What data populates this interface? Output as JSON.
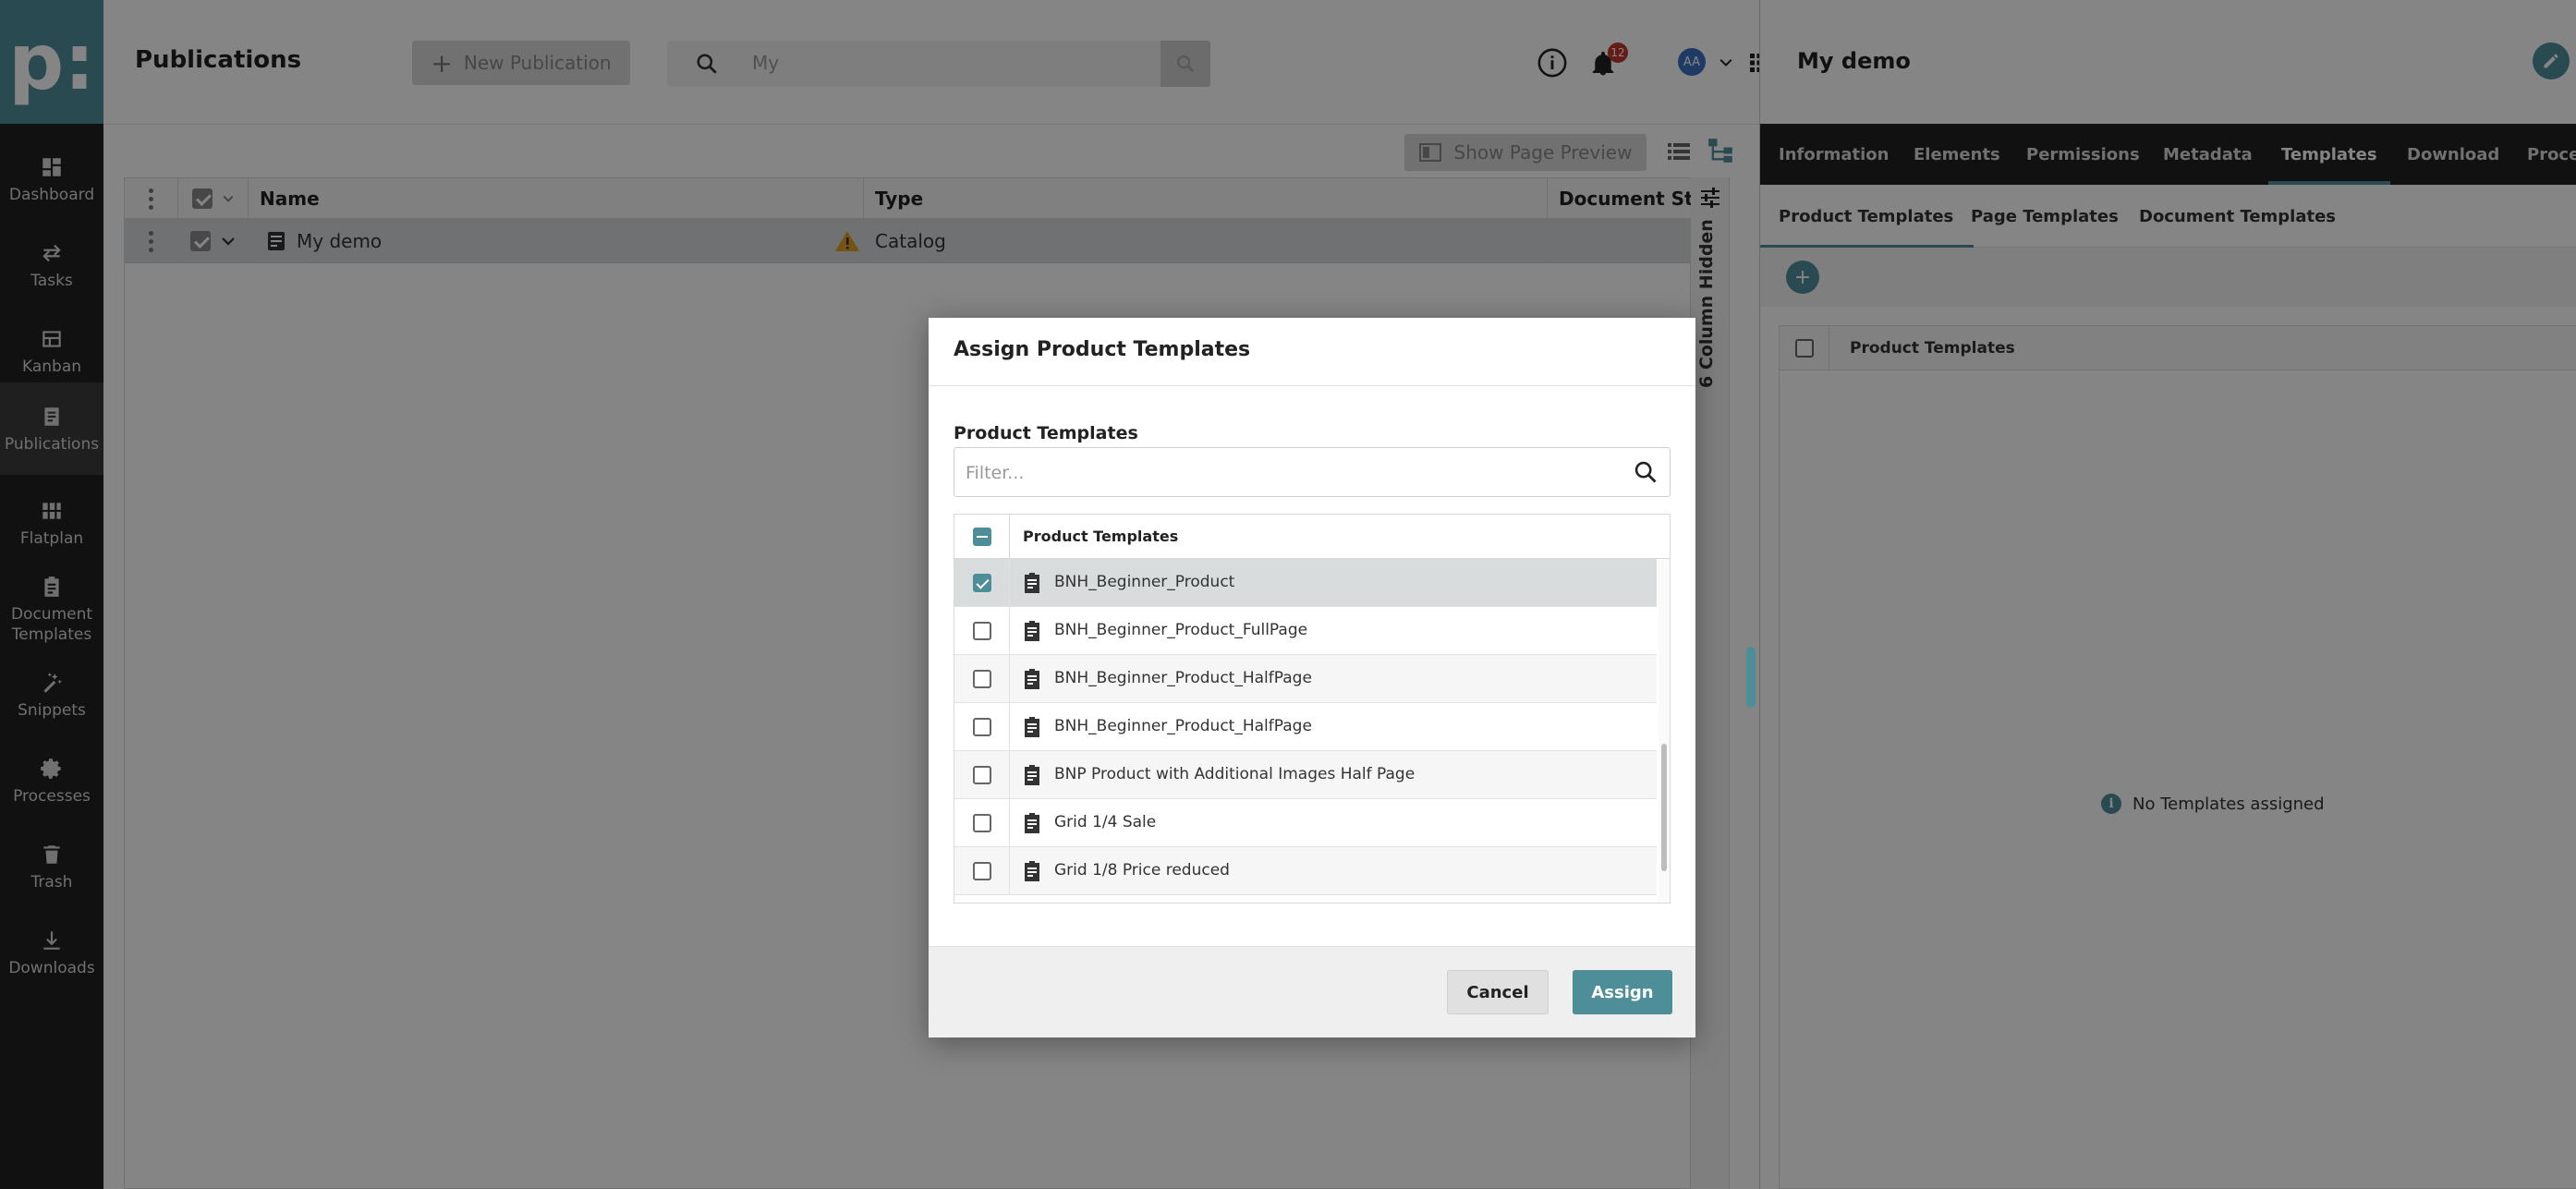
{
  "app": {
    "logo_text": "p:",
    "accent_color": "#4e8e99",
    "sidebar_bg": "#222222"
  },
  "sidebar": {
    "items": [
      {
        "label": "Dashboard",
        "icon": "dashboard-icon"
      },
      {
        "label": "Tasks",
        "icon": "tasks-icon"
      },
      {
        "label": "Kanban",
        "icon": "kanban-icon"
      },
      {
        "label": "Publications",
        "icon": "publications-icon",
        "active": true
      },
      {
        "label": "Flatplan",
        "icon": "flatplan-icon"
      },
      {
        "label": "Document\nTemplates",
        "icon": "document-templates-icon"
      },
      {
        "label": "Snippets",
        "icon": "snippets-icon"
      },
      {
        "label": "Processes",
        "icon": "gear-icon"
      },
      {
        "label": "Trash",
        "icon": "trash-icon"
      },
      {
        "label": "Downloads",
        "icon": "download-icon"
      }
    ]
  },
  "header": {
    "title": "Publications",
    "new_publication_label": "New Publication",
    "search_value": "My",
    "notification_count": "12",
    "avatar_initials": "AA"
  },
  "toolbar": {
    "show_page_preview_label": "Show Page Preview"
  },
  "grid": {
    "columns": [
      "Name",
      "Type",
      "Document St..."
    ],
    "rows": [
      {
        "name": "My demo",
        "type": "Catalog",
        "has_warning": true
      }
    ],
    "hidden_columns_label": "6 Column Hidden"
  },
  "right_panel": {
    "title": "My demo",
    "tabs": [
      "Information",
      "Elements",
      "Permissions",
      "Metadata",
      "Templates",
      "Download",
      "Proces"
    ],
    "active_tab": "Templates",
    "subtabs": [
      "Product Templates",
      "Page Templates",
      "Document Templates"
    ],
    "active_subtab": "Product Templates",
    "table_header": "Product Templates",
    "empty_message": "No Templates assigned"
  },
  "modal": {
    "title": "Assign Product Templates",
    "section_label": "Product Templates",
    "filter_placeholder": "Filter...",
    "list_header": "Product Templates",
    "items": [
      {
        "label": "BNH_Beginner_Product",
        "checked": true
      },
      {
        "label": "BNH_Beginner_Product_FullPage",
        "checked": false
      },
      {
        "label": "BNH_Beginner_Product_HalfPage",
        "checked": false
      },
      {
        "label": "BNH_Beginner_Product_HalfPage",
        "checked": false
      },
      {
        "label": "BNP Product with Additional Images Half Page",
        "checked": false
      },
      {
        "label": "Grid 1/4 Sale",
        "checked": false
      },
      {
        "label": "Grid 1/8 Price reduced",
        "checked": false
      }
    ],
    "cancel_label": "Cancel",
    "assign_label": "Assign"
  }
}
